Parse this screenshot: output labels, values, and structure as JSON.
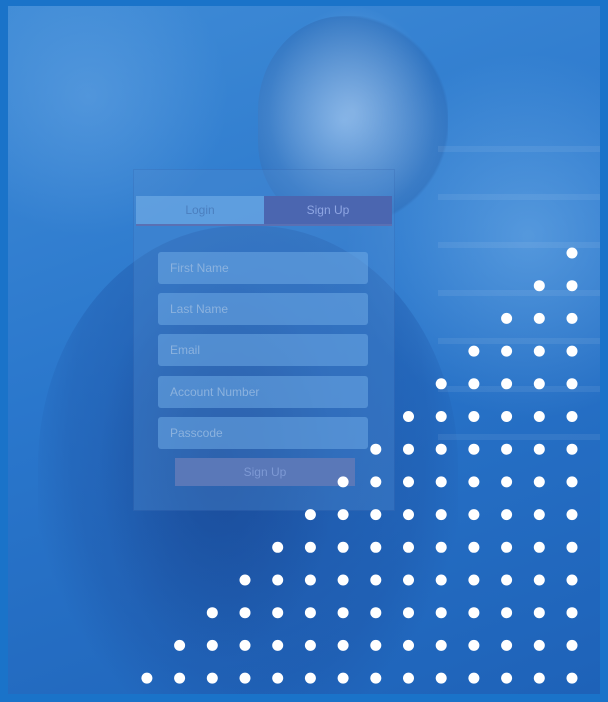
{
  "tabs": {
    "login": "Login",
    "signup": "Sign Up"
  },
  "fields": [
    {
      "placeholder": "First Name"
    },
    {
      "placeholder": "Last Name"
    },
    {
      "placeholder": "Email"
    },
    {
      "placeholder": "Account Number"
    },
    {
      "placeholder": "Passcode"
    }
  ],
  "submit_label": "Sign Up",
  "colors": {
    "accent": "#4b66b0",
    "frame": "#1a73c9",
    "dot": "#ffffff"
  }
}
